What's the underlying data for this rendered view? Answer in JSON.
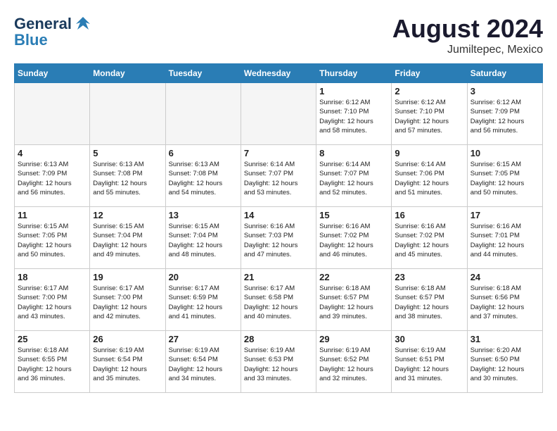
{
  "header": {
    "logo_line1": "General",
    "logo_line2": "Blue",
    "month_title": "August 2024",
    "location": "Jumiltepec, Mexico"
  },
  "days_of_week": [
    "Sunday",
    "Monday",
    "Tuesday",
    "Wednesday",
    "Thursday",
    "Friday",
    "Saturday"
  ],
  "weeks": [
    [
      {
        "day": "",
        "info": ""
      },
      {
        "day": "",
        "info": ""
      },
      {
        "day": "",
        "info": ""
      },
      {
        "day": "",
        "info": ""
      },
      {
        "day": "1",
        "info": "Sunrise: 6:12 AM\nSunset: 7:10 PM\nDaylight: 12 hours\nand 58 minutes."
      },
      {
        "day": "2",
        "info": "Sunrise: 6:12 AM\nSunset: 7:10 PM\nDaylight: 12 hours\nand 57 minutes."
      },
      {
        "day": "3",
        "info": "Sunrise: 6:12 AM\nSunset: 7:09 PM\nDaylight: 12 hours\nand 56 minutes."
      }
    ],
    [
      {
        "day": "4",
        "info": "Sunrise: 6:13 AM\nSunset: 7:09 PM\nDaylight: 12 hours\nand 56 minutes."
      },
      {
        "day": "5",
        "info": "Sunrise: 6:13 AM\nSunset: 7:08 PM\nDaylight: 12 hours\nand 55 minutes."
      },
      {
        "day": "6",
        "info": "Sunrise: 6:13 AM\nSunset: 7:08 PM\nDaylight: 12 hours\nand 54 minutes."
      },
      {
        "day": "7",
        "info": "Sunrise: 6:14 AM\nSunset: 7:07 PM\nDaylight: 12 hours\nand 53 minutes."
      },
      {
        "day": "8",
        "info": "Sunrise: 6:14 AM\nSunset: 7:07 PM\nDaylight: 12 hours\nand 52 minutes."
      },
      {
        "day": "9",
        "info": "Sunrise: 6:14 AM\nSunset: 7:06 PM\nDaylight: 12 hours\nand 51 minutes."
      },
      {
        "day": "10",
        "info": "Sunrise: 6:15 AM\nSunset: 7:05 PM\nDaylight: 12 hours\nand 50 minutes."
      }
    ],
    [
      {
        "day": "11",
        "info": "Sunrise: 6:15 AM\nSunset: 7:05 PM\nDaylight: 12 hours\nand 50 minutes."
      },
      {
        "day": "12",
        "info": "Sunrise: 6:15 AM\nSunset: 7:04 PM\nDaylight: 12 hours\nand 49 minutes."
      },
      {
        "day": "13",
        "info": "Sunrise: 6:15 AM\nSunset: 7:04 PM\nDaylight: 12 hours\nand 48 minutes."
      },
      {
        "day": "14",
        "info": "Sunrise: 6:16 AM\nSunset: 7:03 PM\nDaylight: 12 hours\nand 47 minutes."
      },
      {
        "day": "15",
        "info": "Sunrise: 6:16 AM\nSunset: 7:02 PM\nDaylight: 12 hours\nand 46 minutes."
      },
      {
        "day": "16",
        "info": "Sunrise: 6:16 AM\nSunset: 7:02 PM\nDaylight: 12 hours\nand 45 minutes."
      },
      {
        "day": "17",
        "info": "Sunrise: 6:16 AM\nSunset: 7:01 PM\nDaylight: 12 hours\nand 44 minutes."
      }
    ],
    [
      {
        "day": "18",
        "info": "Sunrise: 6:17 AM\nSunset: 7:00 PM\nDaylight: 12 hours\nand 43 minutes."
      },
      {
        "day": "19",
        "info": "Sunrise: 6:17 AM\nSunset: 7:00 PM\nDaylight: 12 hours\nand 42 minutes."
      },
      {
        "day": "20",
        "info": "Sunrise: 6:17 AM\nSunset: 6:59 PM\nDaylight: 12 hours\nand 41 minutes."
      },
      {
        "day": "21",
        "info": "Sunrise: 6:17 AM\nSunset: 6:58 PM\nDaylight: 12 hours\nand 40 minutes."
      },
      {
        "day": "22",
        "info": "Sunrise: 6:18 AM\nSunset: 6:57 PM\nDaylight: 12 hours\nand 39 minutes."
      },
      {
        "day": "23",
        "info": "Sunrise: 6:18 AM\nSunset: 6:57 PM\nDaylight: 12 hours\nand 38 minutes."
      },
      {
        "day": "24",
        "info": "Sunrise: 6:18 AM\nSunset: 6:56 PM\nDaylight: 12 hours\nand 37 minutes."
      }
    ],
    [
      {
        "day": "25",
        "info": "Sunrise: 6:18 AM\nSunset: 6:55 PM\nDaylight: 12 hours\nand 36 minutes."
      },
      {
        "day": "26",
        "info": "Sunrise: 6:19 AM\nSunset: 6:54 PM\nDaylight: 12 hours\nand 35 minutes."
      },
      {
        "day": "27",
        "info": "Sunrise: 6:19 AM\nSunset: 6:54 PM\nDaylight: 12 hours\nand 34 minutes."
      },
      {
        "day": "28",
        "info": "Sunrise: 6:19 AM\nSunset: 6:53 PM\nDaylight: 12 hours\nand 33 minutes."
      },
      {
        "day": "29",
        "info": "Sunrise: 6:19 AM\nSunset: 6:52 PM\nDaylight: 12 hours\nand 32 minutes."
      },
      {
        "day": "30",
        "info": "Sunrise: 6:19 AM\nSunset: 6:51 PM\nDaylight: 12 hours\nand 31 minutes."
      },
      {
        "day": "31",
        "info": "Sunrise: 6:20 AM\nSunset: 6:50 PM\nDaylight: 12 hours\nand 30 minutes."
      }
    ]
  ]
}
